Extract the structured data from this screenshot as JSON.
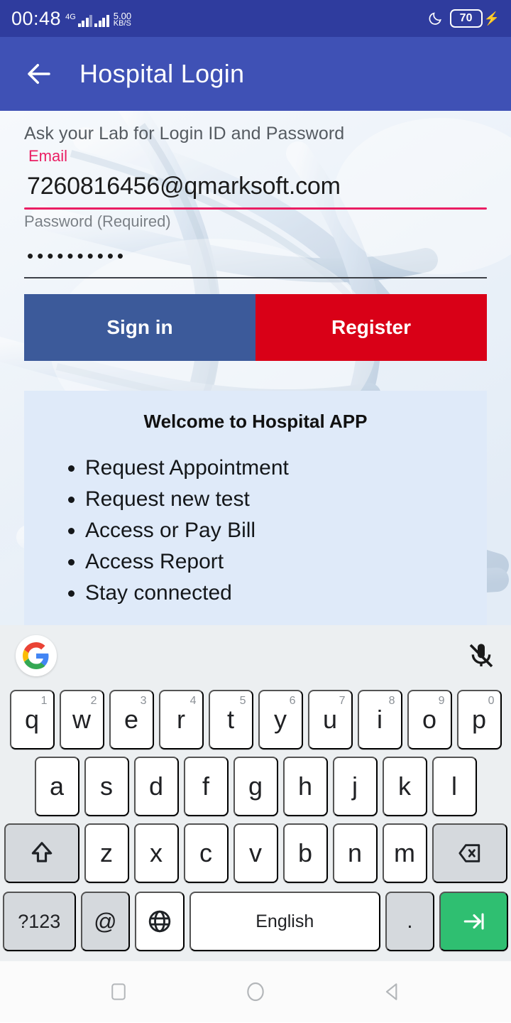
{
  "status_bar": {
    "clock": "00:48",
    "network_type": "4G",
    "data_speed_value": "5.00",
    "data_speed_unit": "KB/S",
    "battery_percent": "70",
    "icons": [
      "signal-icon",
      "moon-icon",
      "battery-icon",
      "charging-bolt-icon"
    ],
    "background_color": "#2f3c9e"
  },
  "app_bar": {
    "title": "Hospital Login",
    "back_label": "Back",
    "background_color": "#3f51b5"
  },
  "form": {
    "hint": "Ask your Lab for Login ID and Password",
    "email": {
      "label": "Email",
      "value": "7260816456@qmarksoft.com",
      "placeholder": "Email",
      "accent_color": "#ea1e63"
    },
    "password": {
      "label": "Password (Required)",
      "value": "••••••••••",
      "placeholder": "Password (Required)",
      "underline_color": "#3d4148"
    }
  },
  "buttons": {
    "sign_in": {
      "label": "Sign in",
      "color": "#3c5a9a"
    },
    "register": {
      "label": "Register",
      "color": "#d90017"
    }
  },
  "welcome_card": {
    "title": "Welcome to Hospital APP",
    "background_color": "#dfeaf9",
    "items": [
      "Request Appointment",
      "Request new test",
      "Access or Pay Bill",
      "Access Report",
      "Stay connected"
    ]
  },
  "keyboard": {
    "toolbar": {
      "logo": "google-g-logo",
      "mic": "mic-muted-icon"
    },
    "row1": [
      {
        "label": "q",
        "num": "1"
      },
      {
        "label": "w",
        "num": "2"
      },
      {
        "label": "e",
        "num": "3"
      },
      {
        "label": "r",
        "num": "4"
      },
      {
        "label": "t",
        "num": "5"
      },
      {
        "label": "y",
        "num": "6"
      },
      {
        "label": "u",
        "num": "7"
      },
      {
        "label": "i",
        "num": "8"
      },
      {
        "label": "o",
        "num": "9"
      },
      {
        "label": "p",
        "num": "0"
      }
    ],
    "row2": [
      {
        "label": "a"
      },
      {
        "label": "s"
      },
      {
        "label": "d"
      },
      {
        "label": "f"
      },
      {
        "label": "g"
      },
      {
        "label": "h"
      },
      {
        "label": "j"
      },
      {
        "label": "k"
      },
      {
        "label": "l"
      }
    ],
    "row3": [
      {
        "label": "z"
      },
      {
        "label": "x"
      },
      {
        "label": "c"
      },
      {
        "label": "v"
      },
      {
        "label": "b"
      },
      {
        "label": "n"
      },
      {
        "label": "m"
      }
    ],
    "shift_key": "shift-icon",
    "backspace_key": "backspace-icon",
    "row4": {
      "symbols": "?123",
      "at": "@",
      "globe": "globe-icon",
      "space": "English",
      "period": ".",
      "enter": "next-field-icon"
    },
    "enter_color": "#2fbf71",
    "background_color": "#eceff1"
  },
  "nav_bar": {
    "recents": "recents-square-icon",
    "home": "home-circle-icon",
    "back": "back-triangle-icon"
  }
}
